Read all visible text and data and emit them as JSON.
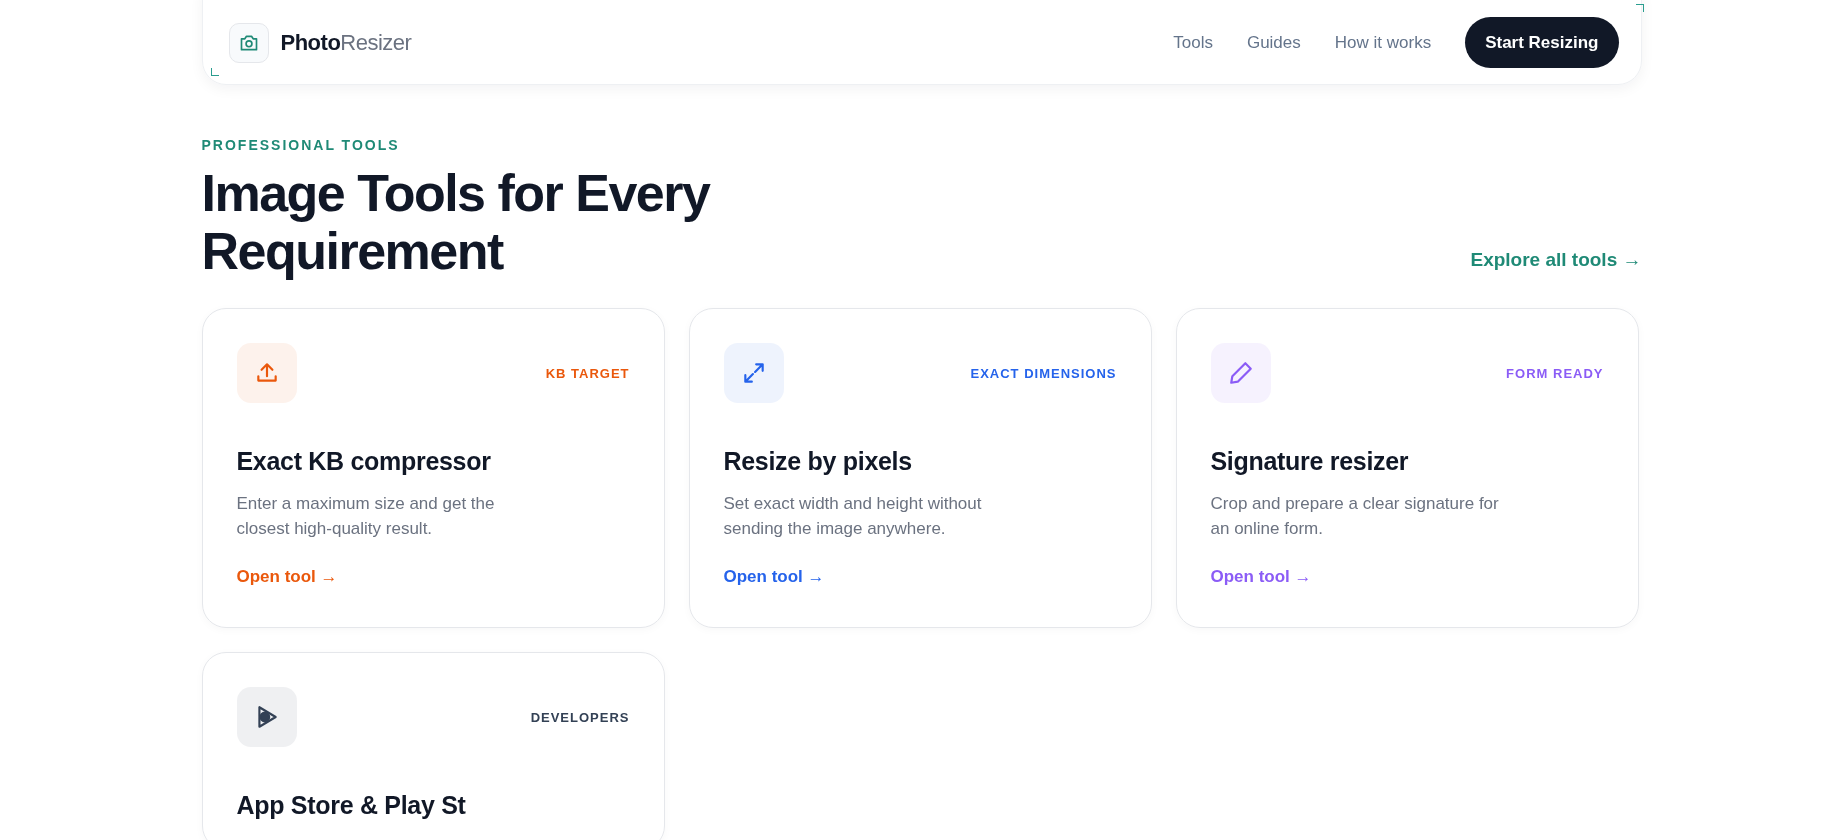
{
  "header": {
    "brand_bold": "Photo",
    "brand_light": "Resizer",
    "nav": [
      "Tools",
      "Guides",
      "How it works"
    ],
    "cta": "Start Resizing"
  },
  "section": {
    "eyebrow": "PROFESSIONAL TOOLS",
    "title": "Image Tools for Every Requirement",
    "explore": "Explore all tools →"
  },
  "cards": [
    {
      "kind": "upload",
      "color": "#ea580c",
      "tag": "KB TARGET",
      "title": "Exact KB compressor",
      "description": "Enter a maximum size and get the closest high-quality result.",
      "link": "Open tool →"
    },
    {
      "kind": "expand",
      "color": "#2563eb",
      "tag": "EXACT DIMENSIONS",
      "title": "Resize by pixels",
      "description": "Set exact width and height without sending the image anywhere.",
      "link": "Open tool →"
    },
    {
      "kind": "pencil",
      "color": "#8b5cf6",
      "tag": "FORM READY",
      "title": "Signature resizer",
      "description": "Crop and prepare a clear signature for an online form.",
      "link": "Open tool →"
    },
    {
      "kind": "play",
      "color": "#334155",
      "tag": "DEVELOPERS",
      "title": "App Store & Play St"
    }
  ]
}
